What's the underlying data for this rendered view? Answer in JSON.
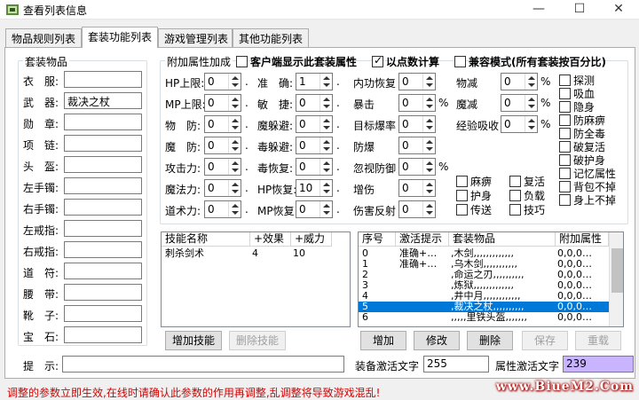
{
  "window": {
    "title": "查看列表信息",
    "minimize": "—",
    "maximize": "☐",
    "close": "✕"
  },
  "tabs": [
    "物品规则列表",
    "套装功能列表",
    "游戏管理列表",
    "其他功能列表"
  ],
  "suit_items": {
    "title": "套装物品",
    "rows": [
      {
        "label": "衣　服:",
        "value": ""
      },
      {
        "label": "武　器:",
        "value": "裁决之杖"
      },
      {
        "label": "勋　章:",
        "value": ""
      },
      {
        "label": "项　链:",
        "value": ""
      },
      {
        "label": "头　盔:",
        "value": ""
      },
      {
        "label": "左手镯:",
        "value": ""
      },
      {
        "label": "右手镯:",
        "value": ""
      },
      {
        "label": "左戒指:",
        "value": ""
      },
      {
        "label": "右戒指:",
        "value": ""
      },
      {
        "label": "道　符:",
        "value": ""
      },
      {
        "label": "腰　带:",
        "value": ""
      },
      {
        "label": "靴　子:",
        "value": ""
      },
      {
        "label": "宝　石:",
        "value": ""
      }
    ]
  },
  "attrs": {
    "title": "附加属性加成",
    "opt1": "客户端显示此套装属性",
    "opt2": "以点数计算",
    "opt3": "兼容模式(所有套装按百分比)",
    "col1": [
      {
        "label": "HP上限:",
        "value": "0"
      },
      {
        "label": "MP上限:",
        "value": "0"
      },
      {
        "label": "物　防:",
        "value": "0"
      },
      {
        "label": "魔　防:",
        "value": "0"
      },
      {
        "label": "攻击力:",
        "value": "0"
      },
      {
        "label": "魔法力:",
        "value": "0"
      },
      {
        "label": "道术力:",
        "value": "0"
      }
    ],
    "col2": [
      {
        "label": "准　确:",
        "value": "1"
      },
      {
        "label": "敏　捷:",
        "value": "0"
      },
      {
        "label": "魔躲避:",
        "value": "0"
      },
      {
        "label": "毒躲避:",
        "value": "0"
      },
      {
        "label": "毒恢复:",
        "value": "0"
      },
      {
        "label": "HP恢复:",
        "value": "10"
      },
      {
        "label": "MP恢复:",
        "value": "0"
      }
    ],
    "col3": [
      {
        "label": "内功恢复",
        "value": "0"
      },
      {
        "label": "暴击",
        "value": "0"
      },
      {
        "label": "目标爆率",
        "value": "0"
      },
      {
        "label": "防爆",
        "value": "0"
      },
      {
        "label": "忽视防御",
        "value": "0"
      },
      {
        "label": "增伤",
        "value": "0"
      },
      {
        "label": "伤害反射",
        "value": "0"
      }
    ],
    "col4": [
      {
        "label": "物减",
        "value": "0"
      },
      {
        "label": "魔减",
        "value": "0"
      },
      {
        "label": "经验吸收",
        "value": "0"
      }
    ],
    "checks_right": [
      "探测",
      "吸血",
      "隐身",
      "防麻痹",
      "防全毒",
      "破复活",
      "破护身",
      "记忆属性",
      "背包不掉",
      "身上不掉"
    ],
    "checks_bottom": [
      "麻痹",
      "复活",
      "护身",
      "负载",
      "传送",
      "技巧"
    ],
    "dot": ".",
    "pct": "%"
  },
  "skills": {
    "headers": [
      "技能名称",
      "+效果",
      "+威力"
    ],
    "rows": [
      {
        "name": "刺杀剑术",
        "effect": "4",
        "power": "10"
      }
    ],
    "add": "增加技能",
    "delete": "删除技能"
  },
  "list": {
    "headers": [
      "序号",
      "激活提示",
      "套装物品",
      "附加属性"
    ],
    "rows": [
      {
        "no": "0",
        "hint": "准确+…",
        "items": ",木剑,,,,,,,,,,,,,",
        "attr": "0,0,0…"
      },
      {
        "no": "1",
        "hint": "准确+…",
        "items": ",乌木剑,,,,,,,,,,,",
        "attr": "0,0,0…"
      },
      {
        "no": "2",
        "hint": "",
        "items": ",命运之刃,,,,,,,,,,",
        "attr": "0,0,0…"
      },
      {
        "no": "3",
        "hint": "",
        "items": ",炼狱,,,,,,,,,,,,,",
        "attr": "0,0,0…"
      },
      {
        "no": "4",
        "hint": "",
        "items": ",井中月,,,,,,,,,,,,",
        "attr": "0,0,0…"
      },
      {
        "no": "5",
        "hint": "",
        "items": ",裁决之杖,,,,,,,,,,",
        "attr": "0,0,0…"
      },
      {
        "no": "6",
        "hint": "",
        "items": ",,,,,里铁头盔,,,,,,,",
        "attr": "0,0,0…"
      }
    ],
    "selected": 5,
    "add": "增加",
    "modify": "修改",
    "delete": "删除",
    "save": "保存",
    "reload": "重载"
  },
  "bottom": {
    "hint_label": "提　示:",
    "hint_value": "",
    "equip_label": "装备激活文字",
    "equip_value": "255",
    "attr_label": "属性激活文字",
    "attr_value": "239"
  },
  "status": "调整的参数立即生效,在线时请确认此参数的作用再调整,乱调整将导致游戏混乱!",
  "watermark": "www.BiueM2.Com",
  "colors": {
    "selected_row": "#0078d7",
    "attr_field": "#c8b4ff",
    "status_text": "#d40000"
  }
}
